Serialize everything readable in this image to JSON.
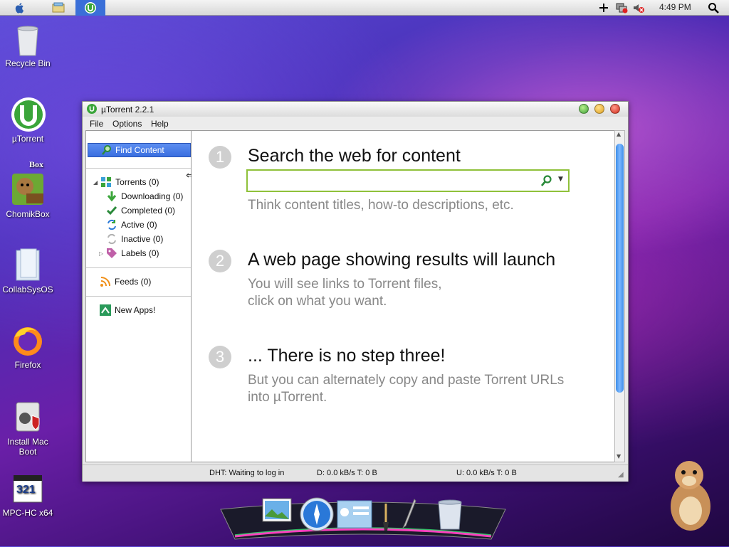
{
  "menubar": {
    "clock": "4:49 PM"
  },
  "desktop": {
    "icons": [
      {
        "label": "Recycle Bin"
      },
      {
        "label": "µTorrent"
      },
      {
        "label": "ChomikBox"
      },
      {
        "label": "CollabSysOS"
      },
      {
        "label": "Firefox"
      },
      {
        "label": "Install Mac Boot"
      },
      {
        "label": "MPC-HC x64"
      }
    ],
    "chomikbox_badge": "Box",
    "mpc_badge": "321"
  },
  "window": {
    "title": "µTorrent 2.2.1",
    "menu": [
      "File",
      "Options",
      "Help"
    ],
    "sidebar": {
      "find_content": "Find Content",
      "torrents": "Torrents (0)",
      "downloading": "Downloading (0)",
      "completed": "Completed (0)",
      "active": "Active (0)",
      "inactive": "Inactive (0)",
      "labels": "Labels (0)",
      "feeds": "Feeds (0)",
      "new_apps": "New Apps!"
    },
    "main": {
      "steps": [
        {
          "num": "1",
          "title": "Search the web for content",
          "desc": "Think content titles, how-to descriptions, etc."
        },
        {
          "num": "2",
          "title": "A web page showing results will launch",
          "desc1": "You will see links to Torrent files,",
          "desc2": "click on what you want."
        },
        {
          "num": "3",
          "title": "... There is no step three!",
          "desc1": "But you can alternately copy and paste Torrent URLs",
          "desc2": "into µTorrent."
        }
      ],
      "search_value": ""
    },
    "status": {
      "dht": "DHT: Waiting to log in",
      "download": "D: 0.0 kB/s T: 0 B",
      "upload": "U: 0.0 kB/s T: 0 B"
    }
  },
  "colors": {
    "accent_green": "#8fc13a",
    "find_button": "#3a6fe0"
  }
}
